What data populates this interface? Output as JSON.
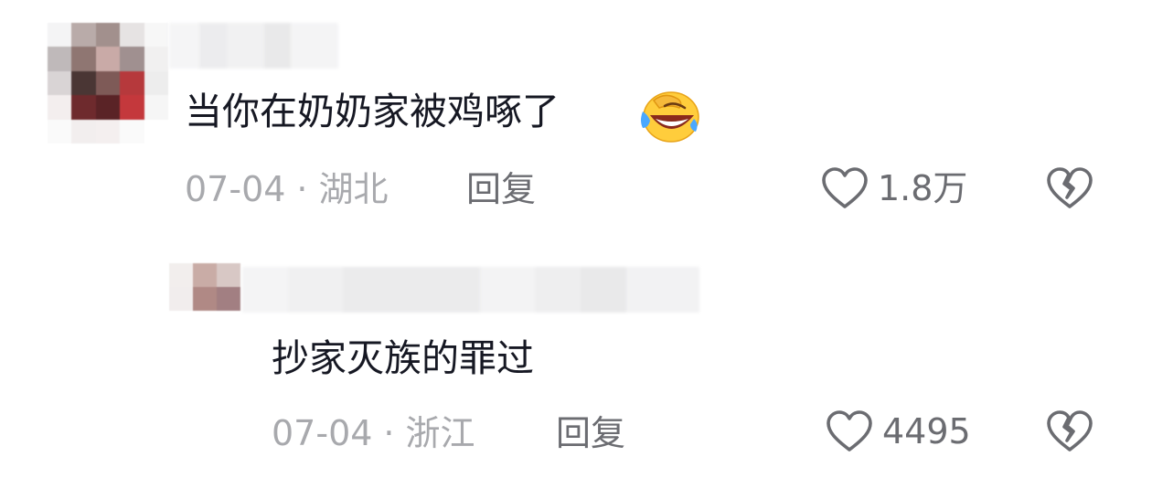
{
  "comments": [
    {
      "text": "当你在奶奶家被鸡啄了",
      "emoji": "face-with-tears-of-joy-icon",
      "date": "07-04",
      "separator": "·",
      "location": "湖北",
      "reply_label": "回复",
      "likes": "1.8万"
    },
    {
      "text": "抄家灭族的罪过",
      "date": "07-04",
      "separator": "·",
      "location": "浙江",
      "reply_label": "回复",
      "likes": "4495"
    }
  ],
  "colors": {
    "text": "#161823",
    "meta": "#a8a9ad",
    "action": "#6b6c71"
  }
}
